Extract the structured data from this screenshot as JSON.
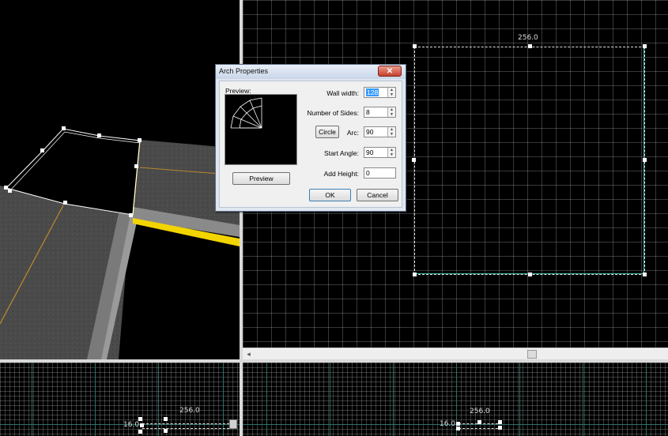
{
  "viewports": {
    "top": {
      "dimension_label": "256.0"
    },
    "front": {
      "dimension_width": "256.0",
      "dimension_height": "16.0"
    },
    "side": {
      "dimension_width": "256.0",
      "dimension_height": "16.0"
    }
  },
  "dialog": {
    "title": "Arch Properties",
    "close_symbol": "✕",
    "preview_label": "Preview:",
    "fields": {
      "wall_width": {
        "label": "Wall width:",
        "value": "128"
      },
      "num_sides": {
        "label": "Number of Sides:",
        "value": "8"
      },
      "arc": {
        "label": "Arc:",
        "value": "90"
      },
      "start_angle": {
        "label": "Start Angle:",
        "value": "90"
      },
      "add_height": {
        "label": "Add Height:",
        "value": "0"
      }
    },
    "buttons": {
      "circle": "Circle",
      "preview": "Preview",
      "ok": "OK",
      "cancel": "Cancel"
    }
  },
  "scrollbar": {
    "left_arrow": "◂",
    "right_arrow": "▸"
  },
  "colors": {
    "grid": "#5a5a5a",
    "axis": "#2f6f6a",
    "selection_cyan": "#3fb8a8",
    "road_line": "#f2d400",
    "text_highlight": "#3399ff"
  }
}
